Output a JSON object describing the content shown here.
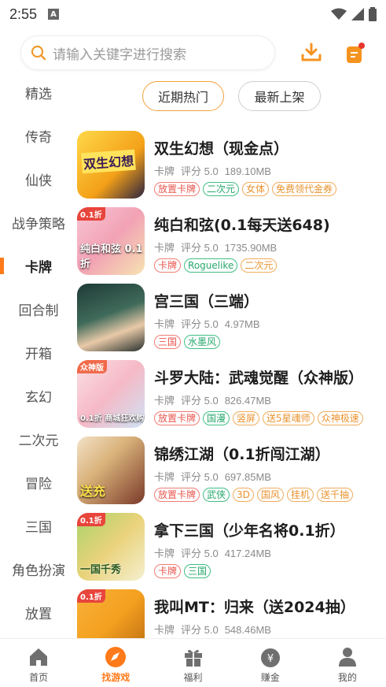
{
  "status": {
    "time": "2:55",
    "a_glyph": "A"
  },
  "search": {
    "placeholder": "请输入关键字进行搜索"
  },
  "sidebar": {
    "items": [
      {
        "label": "精选"
      },
      {
        "label": "传奇"
      },
      {
        "label": "仙侠"
      },
      {
        "label": "战争策略"
      },
      {
        "label": "卡牌",
        "active": true
      },
      {
        "label": "回合制"
      },
      {
        "label": "开箱"
      },
      {
        "label": "玄幻"
      },
      {
        "label": "二次元"
      },
      {
        "label": "冒险"
      },
      {
        "label": "三国"
      },
      {
        "label": "角色扮演"
      },
      {
        "label": "放置"
      }
    ]
  },
  "tabs": {
    "hot": "近期热门",
    "new": "最新上架"
  },
  "games": [
    {
      "title": "双生幻想（现金点）",
      "category": "卡牌",
      "rating": "评分 5.0",
      "size": "189.10MB",
      "tags": [
        {
          "t": "放置卡牌",
          "c": "red"
        },
        {
          "t": "二次元",
          "c": "green"
        },
        {
          "t": "女体",
          "c": "orange"
        },
        {
          "t": "免费领代金券",
          "c": "orange"
        }
      ],
      "cover_text": "双生幻想"
    },
    {
      "title": "纯白和弦(0.1每天送648)",
      "category": "卡牌",
      "rating": "评分 5.0",
      "size": "1735.90MB",
      "tags": [
        {
          "t": "卡牌",
          "c": "red"
        },
        {
          "t": "Roguelike",
          "c": "green"
        },
        {
          "t": "二次元",
          "c": "orange"
        }
      ],
      "cover_text": "纯白和弦 0.1折",
      "badge": "0.1折"
    },
    {
      "title": "宫三国（三端）",
      "category": "卡牌",
      "rating": "评分 5.0",
      "size": "4.97MB",
      "tags": [
        {
          "t": "三国",
          "c": "red"
        },
        {
          "t": "水墨风",
          "c": "green"
        }
      ],
      "cover_text": ""
    },
    {
      "title": "斗罗大陆：武魂觉醒（众神版）",
      "category": "卡牌",
      "rating": "评分 5.0",
      "size": "826.47MB",
      "tags": [
        {
          "t": "放置卡牌",
          "c": "red"
        },
        {
          "t": "国漫",
          "c": "green"
        },
        {
          "t": "竖屏",
          "c": "orange"
        },
        {
          "t": "送5星魂师",
          "c": "orange"
        },
        {
          "t": "众神极速",
          "c": "orange"
        }
      ],
      "cover_text": "0.1折 商城狂欢购",
      "badge": "众神版"
    },
    {
      "title": "锦绣江湖（0.1折闯江湖）",
      "category": "卡牌",
      "rating": "评分 5.0",
      "size": "697.85MB",
      "tags": [
        {
          "t": "放置卡牌",
          "c": "red"
        },
        {
          "t": "武侠",
          "c": "green"
        },
        {
          "t": "3D",
          "c": "orange"
        },
        {
          "t": "国风",
          "c": "orange"
        },
        {
          "t": "挂机",
          "c": "orange"
        },
        {
          "t": "送千抽",
          "c": "orange"
        }
      ],
      "cover_text": "送充"
    },
    {
      "title": "拿下三国（少年名将0.1折）",
      "category": "卡牌",
      "rating": "评分 5.0",
      "size": "417.24MB",
      "tags": [
        {
          "t": "卡牌",
          "c": "red"
        },
        {
          "t": "三国",
          "c": "green"
        }
      ],
      "cover_text": "一国千秀",
      "badge": "0.1折"
    },
    {
      "title": "我叫MT：归来（送2024抽）",
      "category": "卡牌",
      "rating": "评分 5.0",
      "size": "548.46MB",
      "tags": [],
      "cover_text": "",
      "badge": "0.1折"
    }
  ],
  "nav": {
    "home": "首页",
    "find": "找游戏",
    "welfare": "福利",
    "earn": "赚金",
    "mine": "我的"
  },
  "colors": {
    "accent": "#ff7a1a",
    "tag_red": "#e8554e",
    "tag_green": "#26a86b",
    "tag_orange": "#e9922e"
  }
}
